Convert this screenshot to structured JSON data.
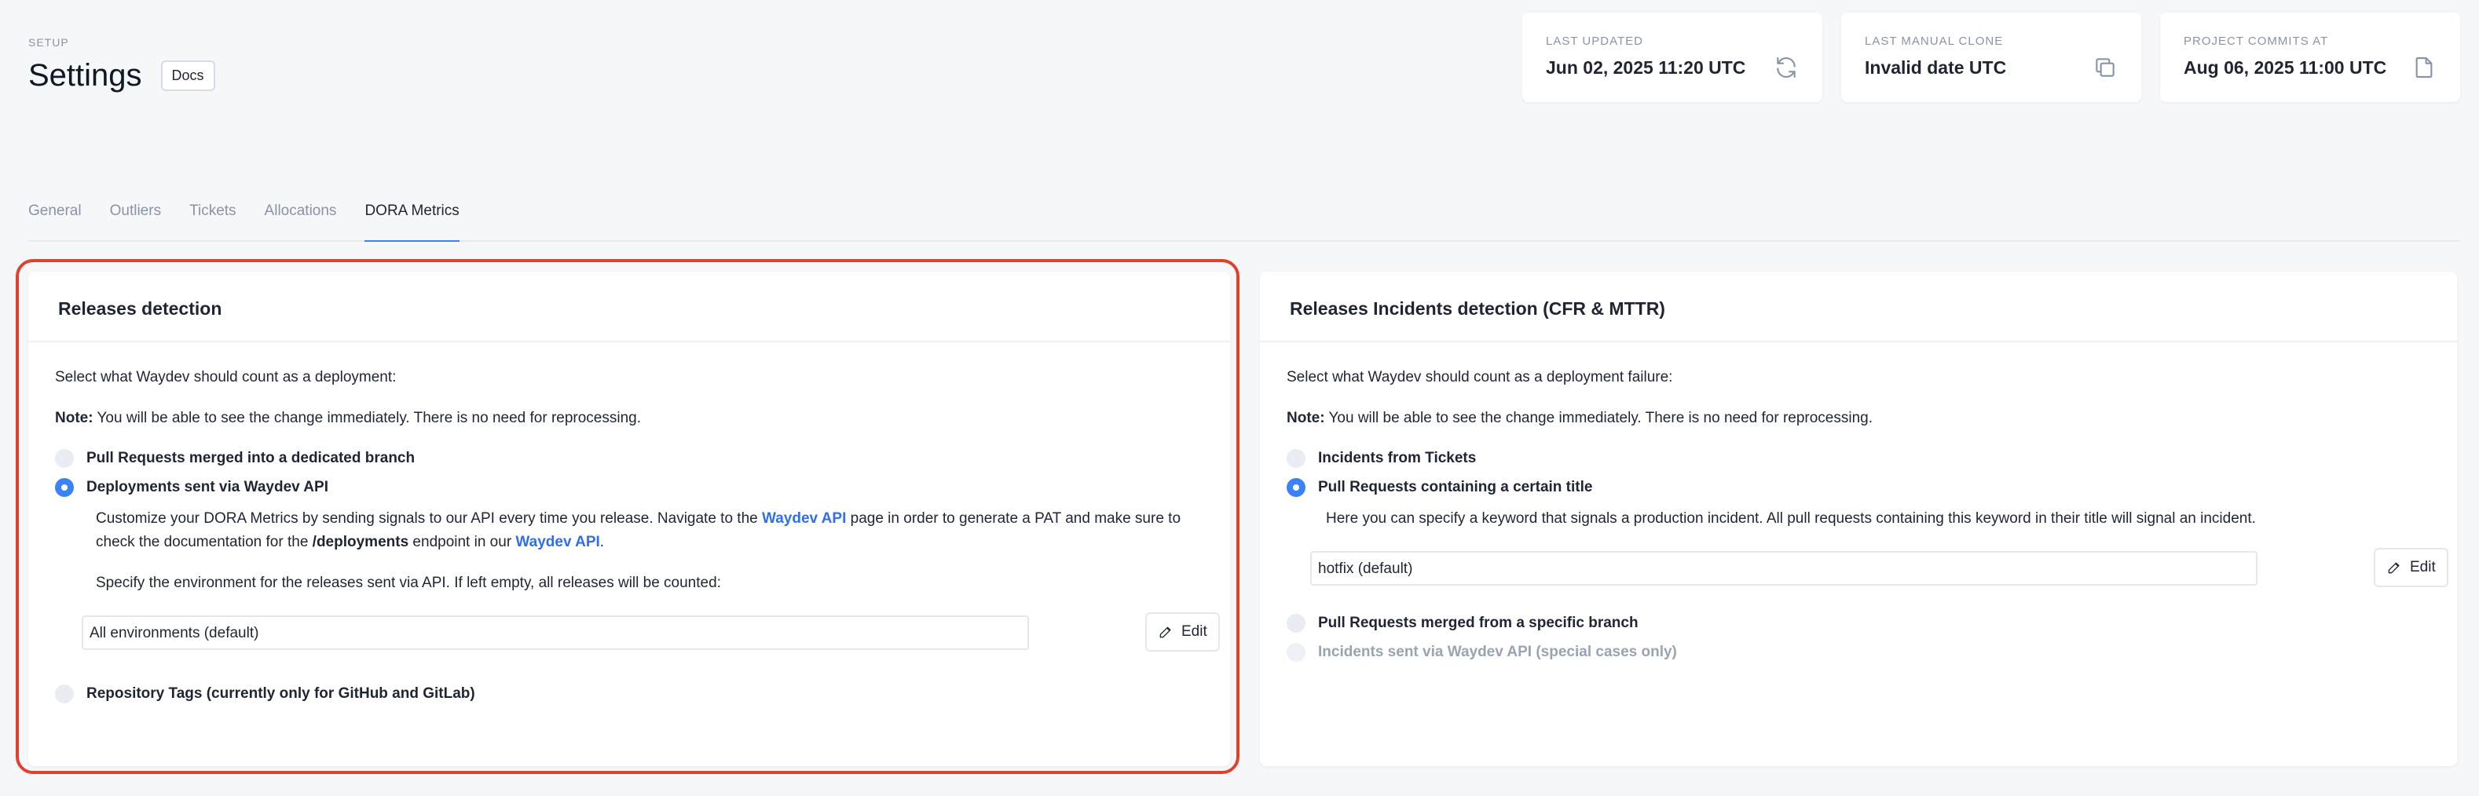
{
  "header": {
    "eyebrow": "SETUP",
    "title": "Settings",
    "docs_label": "Docs"
  },
  "stats": [
    {
      "label": "LAST UPDATED",
      "value": "Jun 02, 2025 11:20 UTC",
      "icon": "refresh-icon"
    },
    {
      "label": "LAST MANUAL CLONE",
      "value": "Invalid date UTC",
      "icon": "copy-icon"
    },
    {
      "label": "PROJECT COMMITS AT",
      "value": "Aug 06, 2025 11:00 UTC",
      "icon": "document-icon"
    }
  ],
  "tabs": [
    "General",
    "Outliers",
    "Tickets",
    "Allocations",
    "DORA Metrics"
  ],
  "active_tab": "DORA Metrics",
  "releases": {
    "title": "Releases detection",
    "intro": "Select what Waydev should count as a deployment:",
    "note_label": "Note:",
    "note_text": " You will be able to see the change immediately. There is no need for reprocessing.",
    "options": [
      "Pull Requests merged into a dedicated branch",
      "Deployments sent via Waydev API",
      "Repository Tags (currently only for GitHub and GitLab)"
    ],
    "selected_option": "Deployments sent via Waydev API",
    "api_desc_1": "Customize your DORA Metrics by sending signals to our API every time you release. Navigate to the ",
    "api_link_1": "Waydev API",
    "api_desc_2": " page in order to generate a PAT and make sure to",
    "api_desc_3": "check the documentation for the ",
    "api_endpoint": "/deployments",
    "api_desc_4": " endpoint in our ",
    "api_link_2": "Waydev API",
    "api_desc_5": ".",
    "env_desc": "Specify the environment for the releases sent via API. If left empty, all releases will be counted:",
    "env_value": "All environments (default)",
    "edit_label": "Edit"
  },
  "incidents": {
    "title": "Releases Incidents detection (CFR & MTTR)",
    "intro": "Select what Waydev should count as a deployment failure:",
    "note_label": "Note:",
    "note_text": " You will be able to see the change immediately. There is no need for reprocessing.",
    "options": [
      "Incidents from Tickets",
      "Pull Requests containing a certain title",
      "Pull Requests merged from a specific branch",
      "Incidents sent via Waydev API (special cases only)"
    ],
    "selected_option": "Pull Requests containing a certain title",
    "title_desc": "Here you can specify a keyword that signals a production incident. All pull requests containing this keyword in their title will signal an incident.",
    "keyword_value": "hotfix (default)",
    "edit_label": "Edit"
  },
  "colors": {
    "accent": "#3b82f6",
    "link": "#2f6fed",
    "highlight": "#e0412d"
  }
}
